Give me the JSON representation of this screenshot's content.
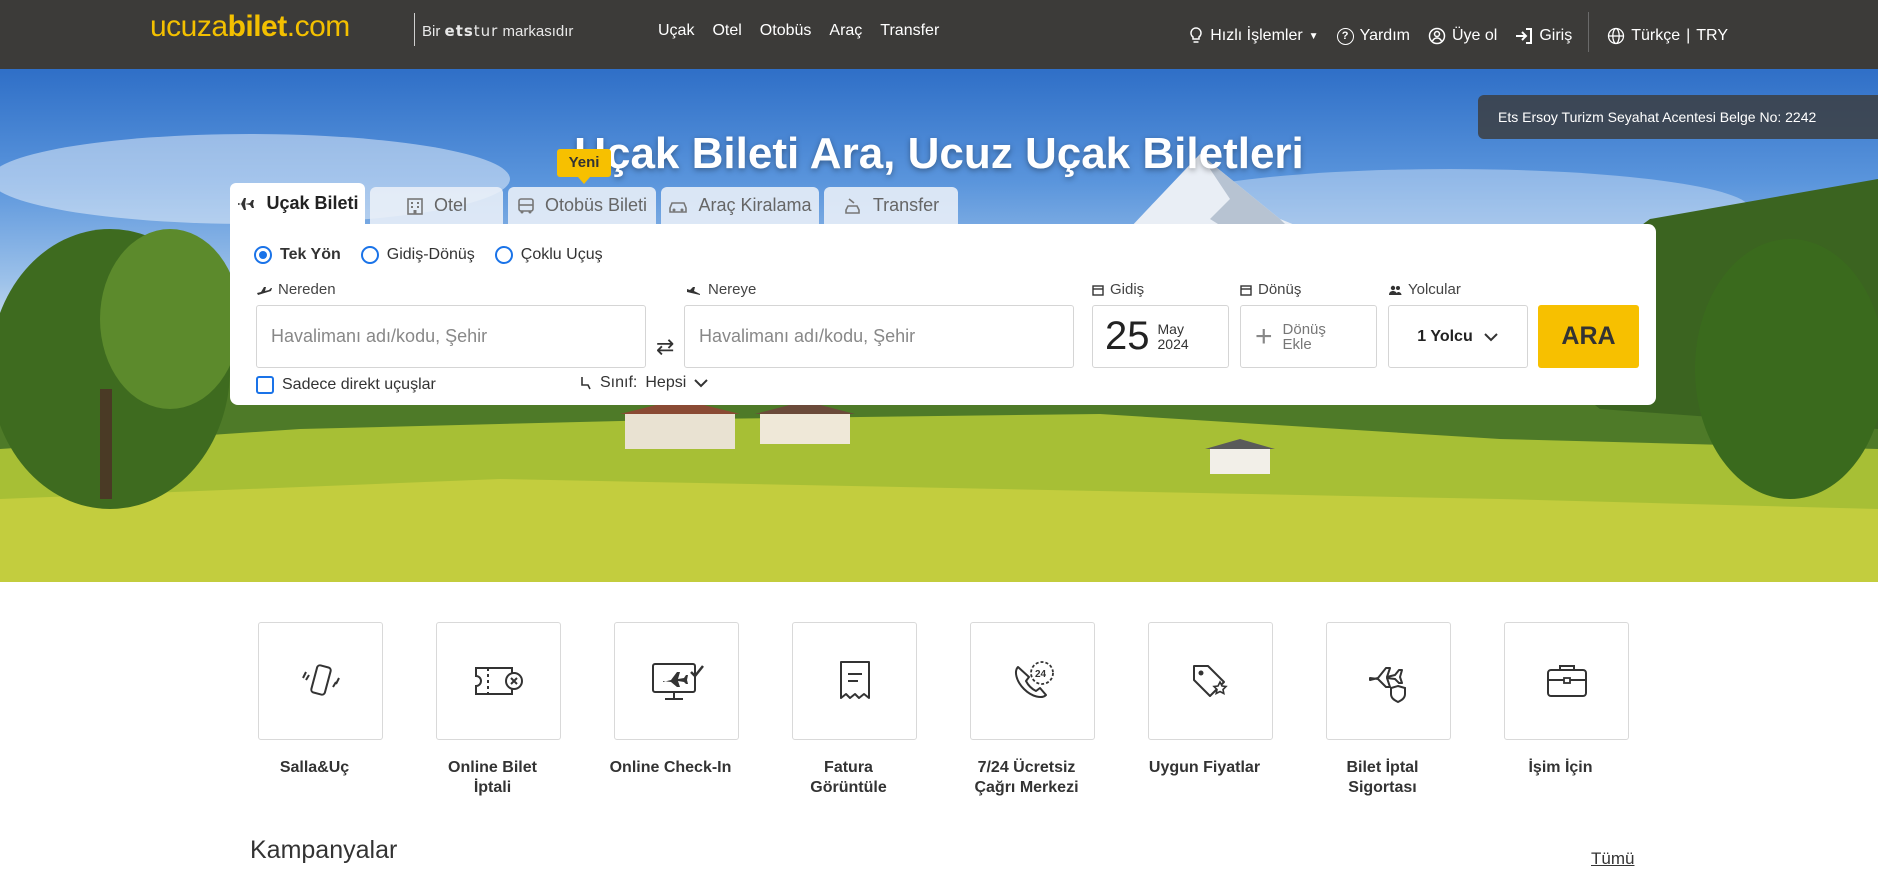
{
  "header": {
    "logo": {
      "part1": "ucuza",
      "part2": "bilet",
      "part3": ".com"
    },
    "brand_tag": {
      "prefix": "Bir",
      "brand_bold": "ets",
      "brand_light": "tur",
      "suffix": "markasıdır"
    },
    "nav": [
      "Uçak",
      "Otel",
      "Otobüs",
      "Araç",
      "Transfer"
    ],
    "right_nav": {
      "quick_actions": "Hızlı İşlemler",
      "help": "Yardım",
      "signup": "Üye ol",
      "login": "Giriş",
      "language": "Türkçe",
      "currency": "TRY"
    }
  },
  "hero": {
    "license": "Ets Ersoy Turizm Seyahat Acentesi Belge No: 2242",
    "title": "Uçak Bileti Ara, Ucuz Uçak Biletleri",
    "new_badge": "Yeni",
    "tabs": [
      "Uçak Bileti",
      "Otel",
      "Otobüs Bileti",
      "Araç Kiralama",
      "Transfer"
    ]
  },
  "search": {
    "trip_types": [
      "Tek Yön",
      "Gidiş-Dönüş",
      "Çoklu Uçuş"
    ],
    "from_label": "Nereden",
    "to_label": "Nereye",
    "placeholder": "Havalimanı adı/kodu, Şehir",
    "depart_label": "Gidiş",
    "return_label": "Dönüş",
    "passengers_label": "Yolcular",
    "depart_day": "25",
    "depart_month": "May",
    "depart_year": "2024",
    "return_line1": "Dönüş",
    "return_line2": "Ekle",
    "passengers_value": "1 Yolcu",
    "search_button": "ARA",
    "direct_only": "Sadece direkt uçuşlar",
    "class_label": "Sınıf:",
    "class_value": "Hepsi"
  },
  "features": [
    {
      "label": "Salla&Uç"
    },
    {
      "label": "Online Bilet İptali"
    },
    {
      "label": "Online Check-In"
    },
    {
      "label": "Fatura Görüntüle"
    },
    {
      "label": "7/24 Ücretsiz Çağrı Merkezi"
    },
    {
      "label": "Uygun Fiyatlar"
    },
    {
      "label": "Bilet İptal Sigortası"
    },
    {
      "label": "İşim İçin"
    }
  ],
  "campaigns": {
    "title": "Kampanyalar",
    "all_link": "Tümü"
  },
  "colors": {
    "accent": "#f7c000",
    "header_bg": "#3c3b39",
    "primary_blue": "#1a73e8"
  }
}
